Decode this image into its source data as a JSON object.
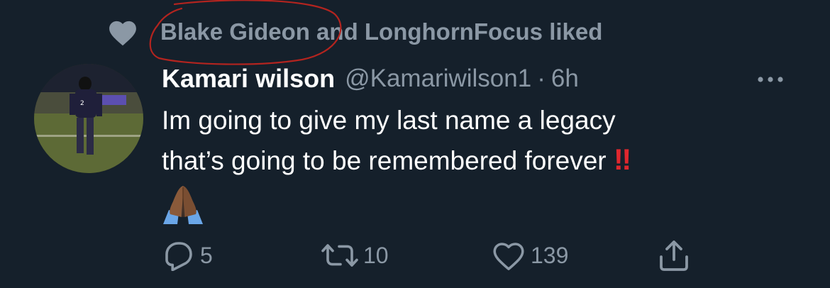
{
  "context": {
    "liked_text": "Blake Gideon and LonghornFocus liked",
    "icon": "heart-filled-icon"
  },
  "tweet": {
    "display_name": "Kamari wilson",
    "handle": "@Kamariwilson1",
    "separator": "·",
    "time": "6h",
    "text_line1": "Im going to give my last name a legacy",
    "text_line2": "that’s going to be remembered forever ",
    "emphasis": "‼",
    "emoji_pray": "🙏🏾"
  },
  "actions": {
    "reply_count": "5",
    "retweet_count": "10",
    "like_count": "139"
  },
  "colors": {
    "background": "#15202b",
    "secondary_text": "#8b98a5",
    "primary_text": "#ffffff",
    "annotation_red": "#b3241f"
  }
}
